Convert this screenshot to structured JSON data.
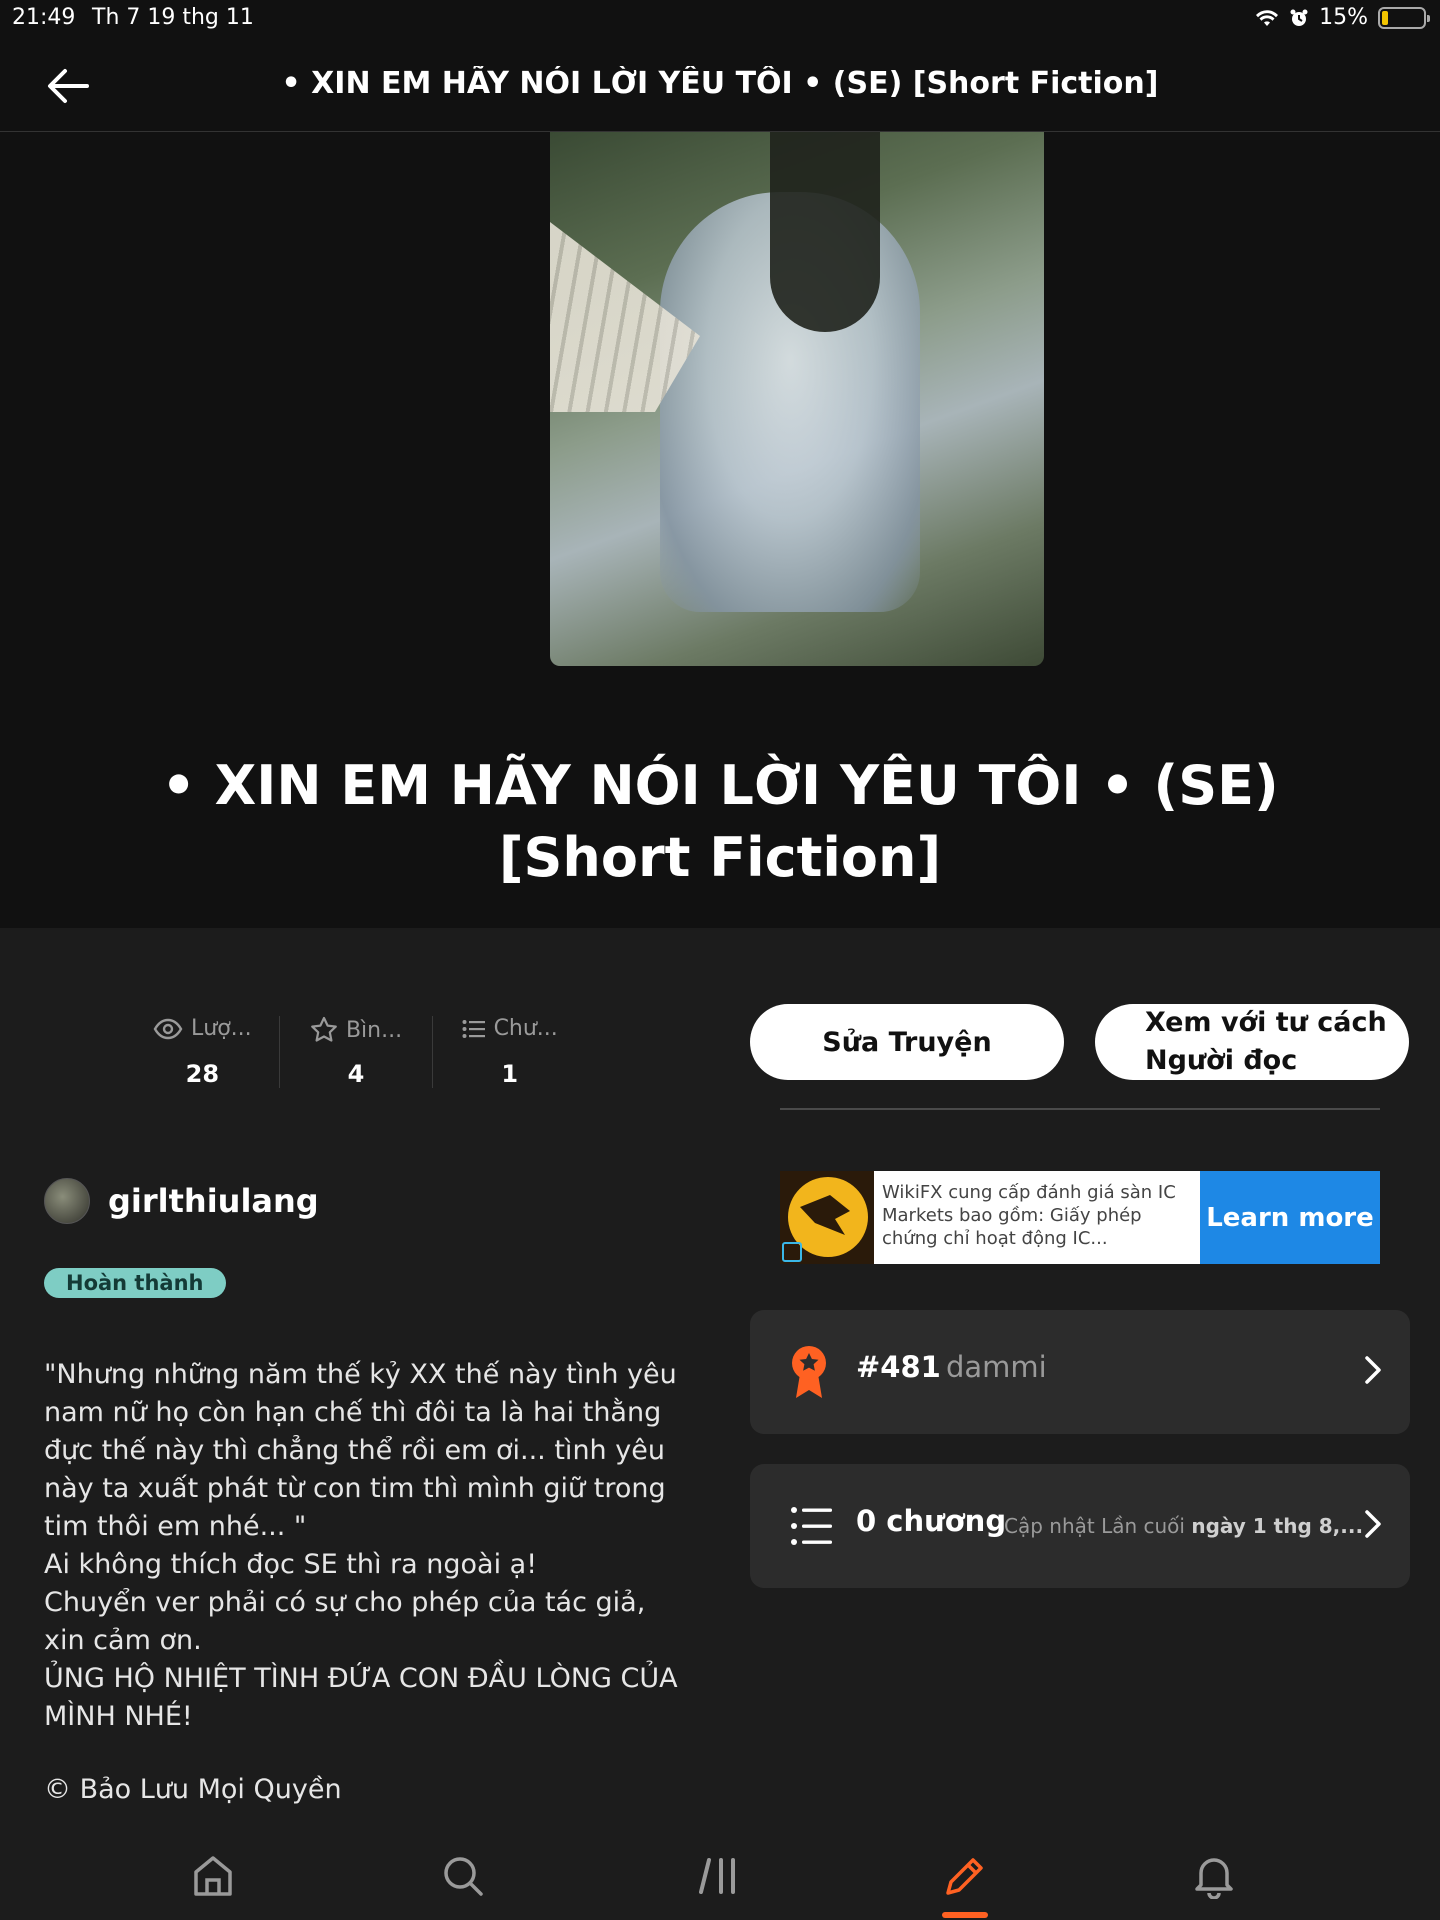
{
  "status_bar": {
    "time": "21:49",
    "date": "Th 7 19 thg 11",
    "battery_text": "15%",
    "battery_level": 0.15
  },
  "nav": {
    "title": "• XIN EM HÃY NÓI LỜI YÊU TÔI •  (SE) [Short Fiction]"
  },
  "story": {
    "title": "• XIN EM HÃY NÓI LỜI YÊU TÔI •  (SE) [Short Fiction]",
    "status_badge": "Hoàn thành"
  },
  "stats": [
    {
      "label": "Lượ...",
      "value": "28",
      "icon": "eye-icon"
    },
    {
      "label": "Bìn...",
      "value": "4",
      "icon": "star-icon"
    },
    {
      "label": "Chư...",
      "value": "1",
      "icon": "list-icon"
    }
  ],
  "actions": {
    "edit_label": "Sửa Truyện",
    "reader_label_line1": "Xem với tư cách",
    "reader_label_line2": "Người đọc"
  },
  "author": {
    "name": "girlthiulang"
  },
  "description": {
    "lines": [
      "\"Nhưng những năm thế kỷ XX thế này tình yêu nam nữ họ còn hạn chế thì đôi ta là hai thằng đực thế này thì chẳng thể rồi em ơi... tình yêu này ta xuất phát từ con tim thì mình giữ trong tim thôi em nhé... \"",
      "Ai không thích đọc SE thì ra ngoài ạ!",
      "Chuyển ver phải có sự cho phép của tác giả, xin cảm ơn.",
      "ỦNG HỘ NHIỆT TÌNH ĐỨA CON ĐẦU LÒNG CỦA MÌNH NHÉ!"
    ],
    "copyright": "© Bảo Lưu Mọi Quyền"
  },
  "ad": {
    "text": "WikiFX cung cấp đánh giá sàn IC Markets bao gồm: Giấy phép chứng chỉ hoạt động IC...",
    "button_label": "Learn more"
  },
  "ranking": {
    "rank": "#481",
    "tag": "dammi"
  },
  "chapters": {
    "count_label": "0 chương",
    "update_prefix": "Cập nhật Lần cuối",
    "update_date": "ngày 1 thg 8,..."
  },
  "tabs": [
    "home-icon",
    "search-icon",
    "library-icon",
    "write-icon",
    "bell-icon"
  ],
  "colors": {
    "accent": "#ff6122",
    "badge": "#7ecdc4",
    "ad_button": "#1e88e5",
    "card": "#2c2c2c"
  }
}
